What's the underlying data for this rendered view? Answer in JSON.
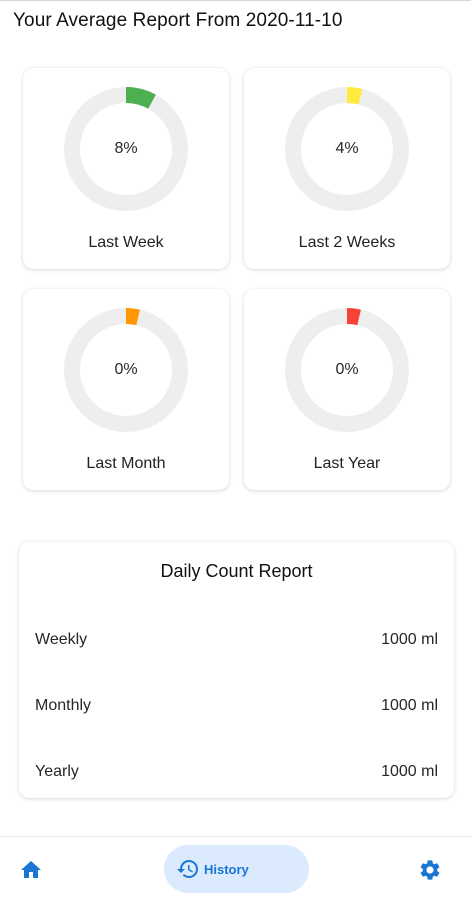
{
  "header": {
    "title": "Your Average Report From 2020-11-10"
  },
  "stats": [
    {
      "label": "Last Week",
      "percent_text": "8%",
      "value": 8,
      "color": "#4caf50"
    },
    {
      "label": "Last 2 Weeks",
      "percent_text": "4%",
      "value": 4,
      "color": "#ffeb3b"
    },
    {
      "label": "Last Month",
      "percent_text": "0%",
      "value": 0,
      "color": "#ff9800"
    },
    {
      "label": "Last Year",
      "percent_text": "0%",
      "value": 0,
      "color": "#f44336"
    }
  ],
  "ring_track_color": "#eeeeee",
  "daily": {
    "title": "Daily Count Report",
    "rows": [
      {
        "label": "Weekly",
        "value": "1000 ml"
      },
      {
        "label": "Monthly",
        "value": "1000 ml"
      },
      {
        "label": "Yearly",
        "value": "1000 ml"
      }
    ]
  },
  "nav": {
    "home_icon": "home-icon",
    "history_icon": "history-icon",
    "history_label": "History",
    "settings_icon": "gear-icon",
    "accent": "#1976d2",
    "pill_bg": "#dbeafd"
  }
}
